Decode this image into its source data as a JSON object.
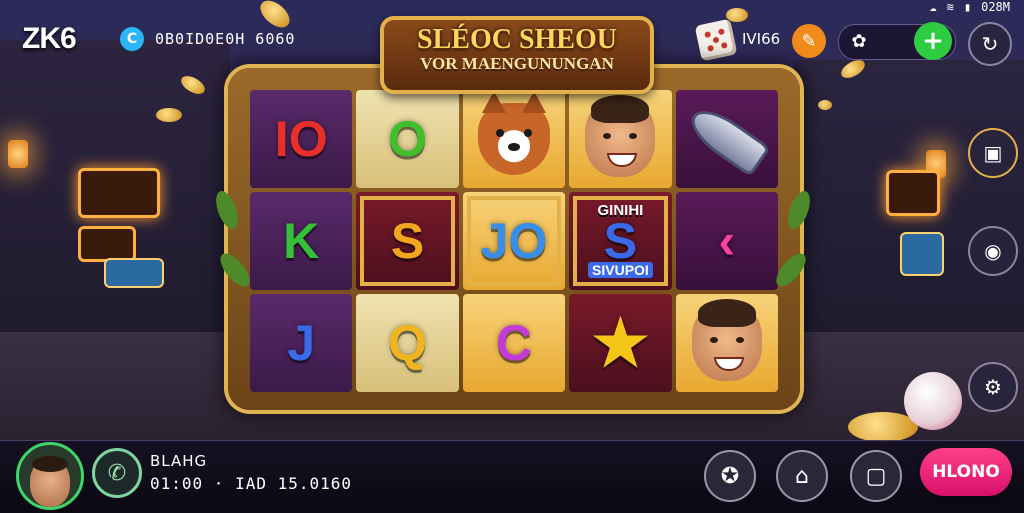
{
  "header": {
    "logo": "ZK6",
    "balance_icon": "C",
    "balance": "0B0ID0E0H 6060",
    "dice_label": "IVI66",
    "status_time": "028M",
    "icons": [
      "dice-icon",
      "feather-icon",
      "gift-icon",
      "plus-icon",
      "refresh-icon"
    ]
  },
  "banner": {
    "line1": "SLÉOC SHEOU",
    "line2": "VOR MAENGUNUNGAN"
  },
  "reels": [
    [
      {
        "text": "IO",
        "color": "#e8302a",
        "bg": "bg-a"
      },
      {
        "text": "K",
        "color": "#35c03a",
        "bg": "bg-a"
      },
      {
        "text": "J",
        "color": "#3a6ae8",
        "bg": "bg-a"
      }
    ],
    [
      {
        "text": "O",
        "color": "#3fc02a",
        "bg": "bg-b"
      },
      {
        "text": "S",
        "color": "#f2a51e",
        "bg": "bg-d",
        "boxed": true
      },
      {
        "text": "Q",
        "color": "#f0b51e",
        "bg": "bg-b"
      }
    ],
    [
      {
        "icon": "fox-icon",
        "bg": "bg-c"
      },
      {
        "text": "JO",
        "color": "#3a8ee8",
        "bg": "bg-c",
        "boxed": true
      },
      {
        "text": "C",
        "color": "#c43ad8",
        "bg": "bg-c"
      }
    ],
    [
      {
        "icon": "man-portrait-icon",
        "bg": "bg-c"
      },
      {
        "text": "S",
        "label_top": "GINIHI",
        "label_bottom": "SIVUPOI",
        "color": "#3a6ae8",
        "bg": "bg-d",
        "boxed": true
      },
      {
        "icon": "star-icon",
        "bg": "bg-d"
      }
    ],
    [
      {
        "icon": "rocket-icon",
        "bg": "bg-e"
      },
      {
        "text": "‹",
        "color": "#ff3fa0",
        "bg": "bg-e"
      },
      {
        "icon": "man-portrait-icon",
        "bg": "bg-c"
      }
    ]
  ],
  "side_buttons": [
    "vault-icon",
    "camera-icon",
    "gear-icon"
  ],
  "footer": {
    "player_name": "BLAHG",
    "player_stats": "01:00 · IAD 15.0160",
    "controls": [
      "emblem-icon",
      "chart-icon",
      "screenshot-icon"
    ],
    "spin_label": "HLONO"
  },
  "colors": {
    "accent_gold": "#e3b04a",
    "spin_pink": "#ff3f8a",
    "plus_green": "#2ecc40",
    "avatar_ring": "#3fd46a"
  }
}
